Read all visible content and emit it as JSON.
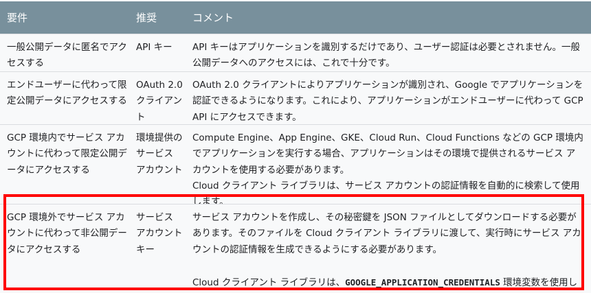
{
  "header": {
    "col1": "要件",
    "col2": "推奨",
    "col3": "コメント"
  },
  "rows": [
    {
      "requirement": "一般公開データに匿名でアクセスする",
      "recommended": "API キー",
      "comment": "API キーはアプリケーションを識別するだけであり、ユーザー認証は必要とされません。一般公開データへのアクセスには、これで十分です。"
    },
    {
      "requirement": "エンドユーザーに代わって限定公開データにアクセスする",
      "recommended": "OAuth 2.0 クライアント",
      "comment": "OAuth 2.0 クライアントによりアプリケーションが識別され、Google でアプリケーションを認証できるようになります。これにより、アプリケーションがエンドユーザーに代わって GCP API にアクセスできます。"
    },
    {
      "requirement": "GCP 環境内でサービス アカウントに代わって限定公開データにアクセスする",
      "recommended": "環境提供のサービス アカウント",
      "comment": "Compute Engine、App Engine、GKE、Cloud Run、Cloud Functions などの GCP 環境内でアプリケーションを実行する場合、アプリケーションはその環境で提供されるサービス アカウントを使用する必要があります。",
      "comment2": "Cloud クライアント ライブラリは、サービス アカウントの認証情報を自動的に検索して使用します。"
    },
    {
      "requirement": "GCP 環境外でサービス アカウントに代わって非公開データにアクセスする",
      "recommended": "サービス アカウント キー",
      "comment": "サービス アカウントを作成し、その秘密鍵を JSON ファイルとしてダウンロードする必要があります。そのファイルを Cloud クライアント ライブラリに渡して、実行時にサービス アカウントの認証情報を生成できるようにする必要があります。",
      "comment2_pre": "Cloud クライアント ライブラリは、",
      "comment2_code": "GOOGLE_APPLICATION_CREDENTIALS",
      "comment2_post": " 環境変数を使用して、サービス アカウントの認証情報を自動的に検索して使用します。"
    }
  ],
  "colors": {
    "header": "#78909c",
    "highlight": "#ff0000"
  }
}
